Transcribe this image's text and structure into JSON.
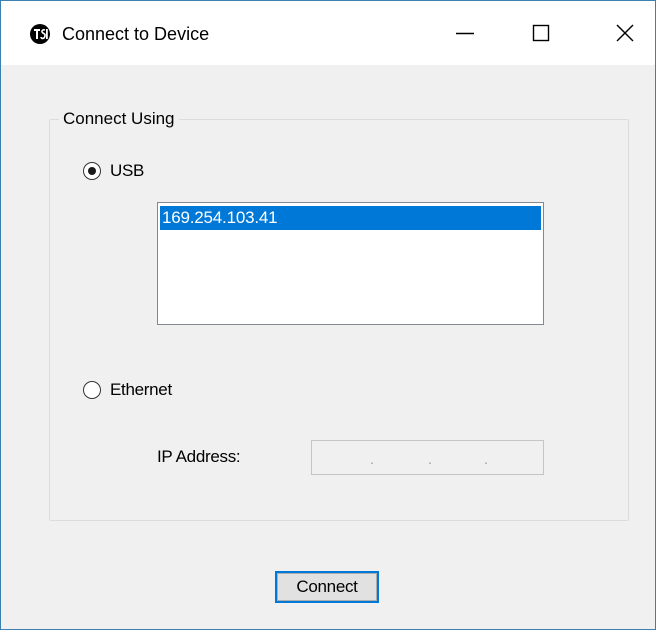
{
  "window": {
    "title": "Connect to Device",
    "icon": "tsi-logo-icon",
    "controls": {
      "minimize": "minimize-icon",
      "maximize": "maximize-icon",
      "close": "close-icon"
    }
  },
  "group": {
    "label": "Connect Using"
  },
  "options": {
    "usb_label": "USB",
    "usb_selected": true,
    "ethernet_label": "Ethernet",
    "ethernet_selected": false
  },
  "device_list": {
    "items": [
      "169.254.103.41"
    ],
    "selected_index": 0
  },
  "ip": {
    "label": "IP Address:",
    "separator": "."
  },
  "actions": {
    "connect_label": "Connect"
  },
  "colors": {
    "accent": "#0078d7",
    "window_border": "#3c7fb1",
    "dialog_bg": "#f0f0f0"
  }
}
